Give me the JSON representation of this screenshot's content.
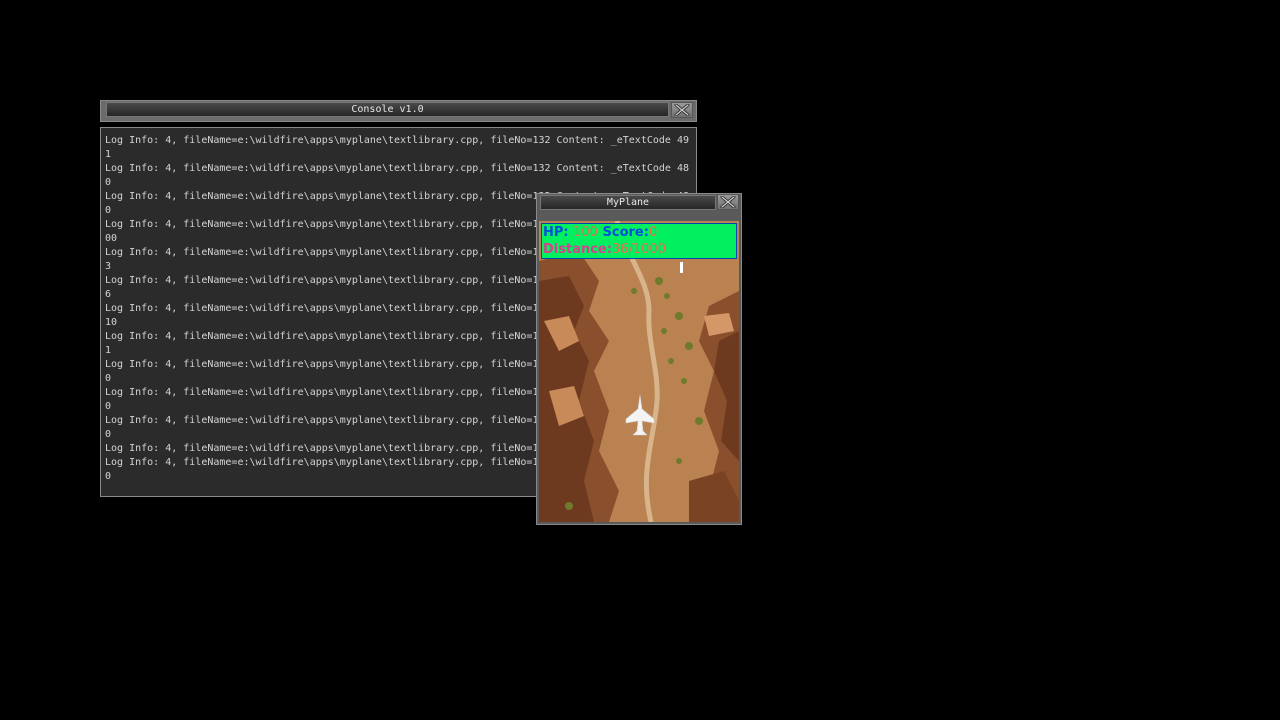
{
  "console": {
    "title": "Console v1.0",
    "lines": [
      "Log Info: 4, fileName=e:\\wildfire\\apps\\myplane\\textlibrary.cpp, fileNo=132 Content: _eTextCode 49",
      "1",
      "Log Info: 4, fileName=e:\\wildfire\\apps\\myplane\\textlibrary.cpp, fileNo=132 Content: _eTextCode 48",
      "0",
      "Log Info: 4, fileName=e:\\wildfire\\apps\\myplane\\textlibrary.cpp, fileNo=132 Content: _eTextCode 48",
      "0",
      "Log Info: 4, fileName=e:\\wildfire\\apps\\myplane\\textlibrary.cpp, fileNo=1",
      "00",
      "Log Info: 4, fileName=e:\\wildfire\\apps\\myplane\\textlibrary.cpp, fileNo=1",
      "3",
      "Log Info: 4, fileName=e:\\wildfire\\apps\\myplane\\textlibrary.cpp, fileNo=1",
      "6",
      "Log Info: 4, fileName=e:\\wildfire\\apps\\myplane\\textlibrary.cpp, fileNo=1",
      "10",
      "Log Info: 4, fileName=e:\\wildfire\\apps\\myplane\\textlibrary.cpp, fileNo=1",
      "1",
      "Log Info: 4, fileName=e:\\wildfire\\apps\\myplane\\textlibrary.cpp, fileNo=1",
      "0",
      "Log Info: 4, fileName=e:\\wildfire\\apps\\myplane\\textlibrary.cpp, fileNo=1",
      "0",
      "Log Info: 4, fileName=e:\\wildfire\\apps\\myplane\\textlibrary.cpp, fileNo=1",
      "0",
      "Log Info: 4, fileName=e:\\wildfire\\apps\\myplane\\textlibrary.cpp, fileNo=1",
      "Log Info: 4, fileName=e:\\wildfire\\apps\\myplane\\textlibrary.cpp, fileNo=1",
      "0"
    ],
    "close_icon": "close-x-icon"
  },
  "game": {
    "title": "MyPlane",
    "hud": {
      "hp_label": "HP:",
      "hp_value": "100",
      "score_label": "Score:",
      "score_value": "0",
      "distance_label": "Distance:",
      "distance_value": "36/1000"
    },
    "close_icon": "close-x-icon",
    "player_icon": "player-plane-icon"
  }
}
